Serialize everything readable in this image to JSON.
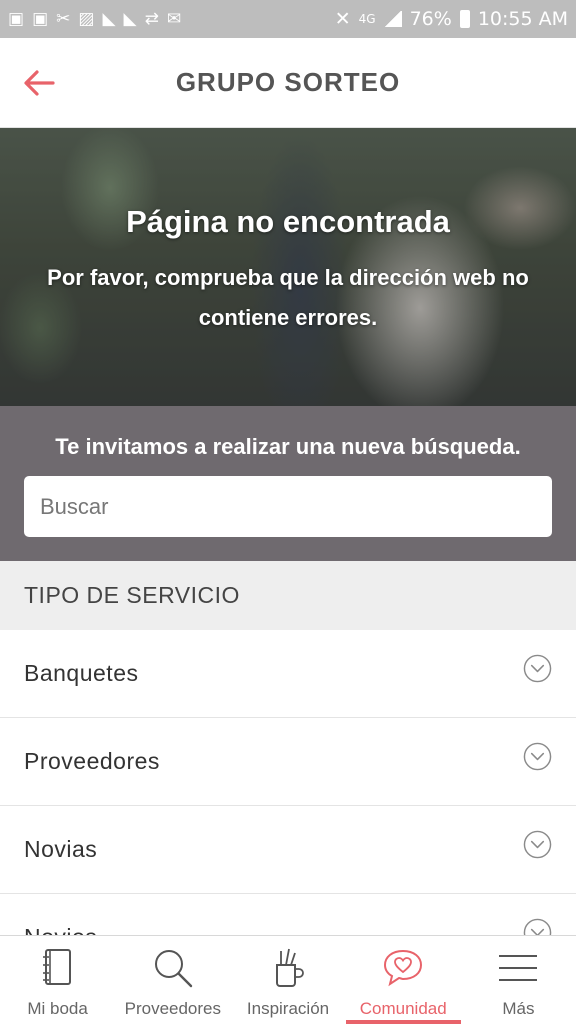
{
  "status_bar": {
    "battery": "76%",
    "time": "10:55 AM",
    "network": "4G"
  },
  "header": {
    "title": "GRUPO SORTEO"
  },
  "hero": {
    "title": "Página no encontrada",
    "message": "Por favor, comprueba que la dirección web no contiene errores."
  },
  "search": {
    "prompt": "Te invitamos a realizar una nueva búsqueda.",
    "placeholder": "Buscar"
  },
  "filters": {
    "header": "TIPO DE SERVICIO",
    "items": [
      {
        "label": "Banquetes"
      },
      {
        "label": "Proveedores"
      },
      {
        "label": "Novias"
      },
      {
        "label": "Novios"
      }
    ]
  },
  "bottom_nav": {
    "items": [
      {
        "label": "Mi boda",
        "icon": "notebook-icon"
      },
      {
        "label": "Proveedores",
        "icon": "search-icon"
      },
      {
        "label": "Inspiración",
        "icon": "pencil-cup-icon"
      },
      {
        "label": "Comunidad",
        "icon": "heart-chat-icon",
        "active": true
      },
      {
        "label": "Más",
        "icon": "menu-icon"
      }
    ]
  },
  "colors": {
    "accent": "#e8636a",
    "search_bg": "#6f6a6f",
    "filter_header_bg": "#eeeeee"
  }
}
